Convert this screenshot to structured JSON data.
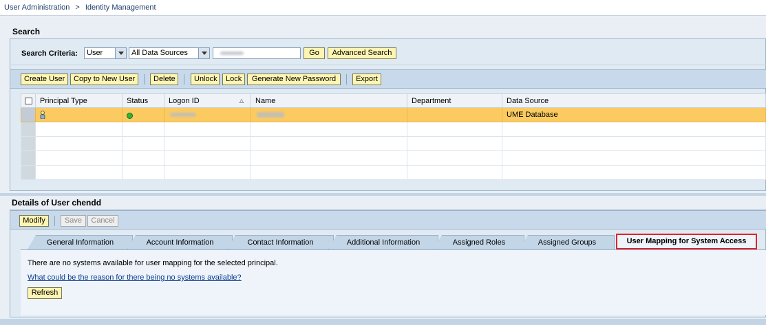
{
  "breadcrumb": [
    "User Administration",
    ">",
    "Identity Management"
  ],
  "search": {
    "title": "Search",
    "criteria_label": "Search Criteria:",
    "type_select": "User",
    "source_select": "All Data Sources",
    "go_label": "Go",
    "advanced_label": "Advanced Search"
  },
  "toolbar": {
    "create_user": "Create User",
    "copy_user": "Copy to New User",
    "delete": "Delete",
    "unlock": "Unlock",
    "lock": "Lock",
    "generate_password": "Generate New Password",
    "export": "Export"
  },
  "table": {
    "columns": [
      "Principal Type",
      "Status",
      "Logon ID",
      "Name",
      "Department",
      "Data Source"
    ],
    "sorted_column": "Logon ID",
    "rows": [
      {
        "principal_type": "user-icon",
        "status": "green",
        "logon_id": "",
        "name": "",
        "department": "",
        "data_source": "UME Database"
      }
    ]
  },
  "details": {
    "title": "Details of User chendd",
    "modify_label": "Modify",
    "save_label": "Save",
    "cancel_label": "Cancel",
    "tabs": [
      "General Information",
      "Account Information",
      "Contact Information",
      "Additional Information",
      "Assigned Roles",
      "Assigned Groups",
      "User Mapping for System Access"
    ],
    "active_tab": "User Mapping for System Access",
    "message": "There are no systems available for user mapping for the selected principal.",
    "help_link": "What could be the reason for there being no systems available?",
    "refresh_label": "Refresh"
  },
  "colors": {
    "selected_row": "#fbcb61",
    "button_bg": "#fef5b3",
    "active_tab_border": "#e0222a"
  }
}
